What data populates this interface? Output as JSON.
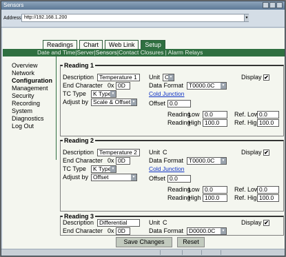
{
  "window": {
    "title": "Sensors"
  },
  "address_bar": {
    "label": "Address",
    "url": "http://192.168.1.200"
  },
  "tabs": [
    {
      "label": "Readings",
      "active": false
    },
    {
      "label": "Chart",
      "active": false
    },
    {
      "label": "Web Link",
      "active": false
    },
    {
      "label": "Setup",
      "active": true
    }
  ],
  "subnav": {
    "before": "Date and Time|Server|",
    "selected": "Sensors",
    "after": "|Contact Closures | Alarm Relays"
  },
  "sidebar": {
    "items": [
      {
        "label": "Overview"
      },
      {
        "label": "Network"
      },
      {
        "label": "Configuration",
        "current": true
      },
      {
        "label": "Management"
      },
      {
        "label": "Security"
      },
      {
        "label": "Recording"
      },
      {
        "label": "System"
      },
      {
        "label": "Diagnostics"
      },
      {
        "label": "Log Out"
      }
    ]
  },
  "labels": {
    "description": "Description",
    "end_character": "End Character",
    "hex_prefix": "0x",
    "tc_type": "TC Type",
    "adjust_by": "Adjust by",
    "unit": "Unit",
    "display": "Display",
    "data_format": "Data Format",
    "cold_junction": "Cold Junction",
    "offset": "Offset",
    "reading_low": "Reading",
    "low": "Low",
    "reading_high": "Reading",
    "high": "High",
    "ref_low": "Ref. Low",
    "ref_high": "Ref. High"
  },
  "readings": [
    {
      "legend": "Reading 1",
      "description": "Temperature 1",
      "end_character": "0D",
      "tc_type": "K Type",
      "adjust_by": "Scale & Offset",
      "unit": "C",
      "display_checked": "✔",
      "data_format": "T0000.0C",
      "offset": "0.0",
      "reading_low": "0.0",
      "reading_high": "100.0",
      "ref_low": "0.0",
      "ref_high": "100.0"
    },
    {
      "legend": "Reading 2",
      "description": "Temperature 2",
      "end_character": "0D",
      "tc_type": "K Type",
      "adjust_by": "Offset",
      "unit": "C",
      "display_checked": "✔",
      "data_format": "T0000.0C",
      "offset": "0.0",
      "reading_low": "0.0",
      "reading_high": "100.0",
      "ref_low": "0.0",
      "ref_high": "100.0"
    },
    {
      "legend": "Reading 3",
      "description": "Differential",
      "end_character": "0D",
      "unit": "C",
      "display_checked": "✔",
      "data_format": "D0000.0C"
    }
  ],
  "buttons": {
    "save": "Save Changes",
    "reset": "Reset"
  },
  "colors": {
    "nav_green": "#2f6f40",
    "link_blue": "#0b2fc4",
    "window_blue": "#5d7996"
  }
}
